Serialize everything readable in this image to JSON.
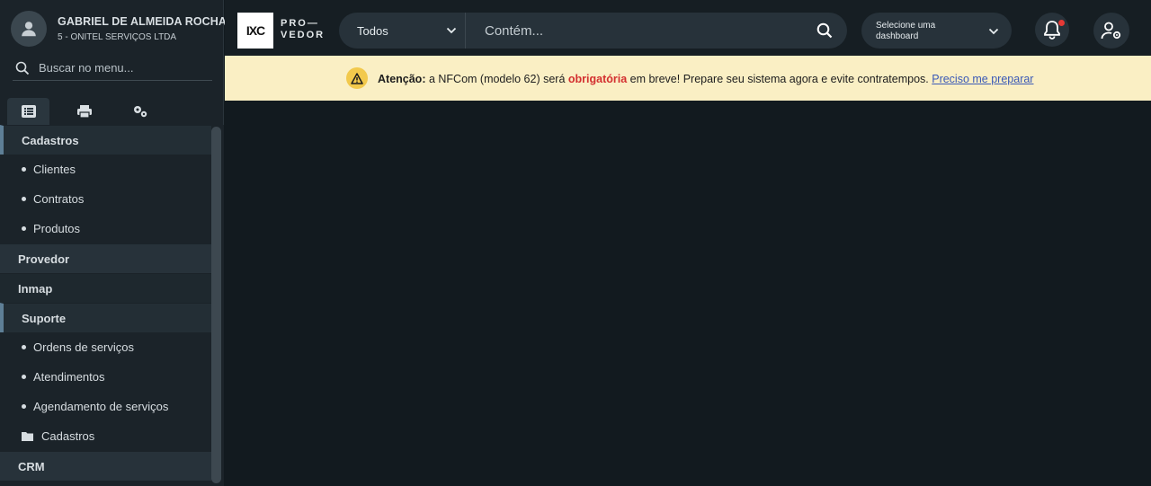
{
  "user": {
    "name": "GABRIEL DE ALMEIDA ROCHA",
    "company": "5 - ONITEL SERVIÇOS LTDA"
  },
  "sidebar": {
    "search_placeholder": "Buscar no menu...",
    "tabs": [
      {
        "icon": "list-icon",
        "active": true
      },
      {
        "icon": "printer-icon",
        "active": false
      },
      {
        "icon": "gears-icon",
        "active": false
      }
    ],
    "menu": {
      "cadastros": "Cadastros",
      "clientes": "Clientes",
      "contratos": "Contratos",
      "produtos": "Produtos",
      "provedor": "Provedor",
      "inmap": "Inmap",
      "suporte": "Suporte",
      "ordens": "Ordens de serviços",
      "atendimentos": "Atendimentos",
      "agendamento": "Agendamento de serviços",
      "cadastros_folder": "Cadastros",
      "crm": "CRM"
    }
  },
  "header": {
    "logo_mark": "IXC",
    "logo_line1": "PRO—",
    "logo_line2": "VEDOR",
    "filter_value": "Todos",
    "search_placeholder": "Contém...",
    "dashboard_placeholder": "Selecione uma dashboard",
    "notification_color": "#e53935"
  },
  "banner": {
    "label": "Atenção:",
    "text_before": " a NFCom (modelo 62) será ",
    "highlight": "obrigatória",
    "text_after": " em breve! Prepare seu sistema agora e evite contratempos. ",
    "link": "Preciso me preparar",
    "background": "#faefc4"
  }
}
